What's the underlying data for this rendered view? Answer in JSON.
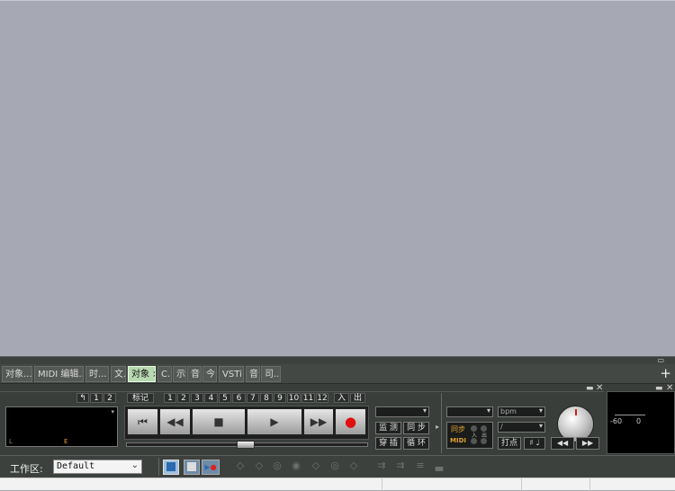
{
  "tabs": [
    {
      "label": "对象..."
    },
    {
      "label": "MIDI 编辑..."
    },
    {
      "label": "时..."
    },
    {
      "label": "文..."
    },
    {
      "label": "对象 ×"
    },
    {
      "label": "C..."
    },
    {
      "label": "示..."
    },
    {
      "label": "音..."
    },
    {
      "label": "今..."
    },
    {
      "label": "VSTi"
    },
    {
      "label": "音..."
    },
    {
      "label": "司..."
    }
  ],
  "add_tab_label": "+",
  "transport": {
    "back_label": "↰",
    "page1": "1",
    "page2": "2",
    "marker_label": "标记",
    "markers": [
      "1",
      "2",
      "3",
      "4",
      "5",
      "6",
      "7",
      "8",
      "9",
      "10",
      "11",
      "12"
    ],
    "in_label": "入",
    "out_label": "出",
    "display_left": "L",
    "display_end": "E",
    "rewind_start": "⏮",
    "rewind": "◀◀",
    "stop": "■",
    "play": "▶",
    "forward": "▶▶",
    "record": "●"
  },
  "switches": {
    "monitor": "监 测",
    "sync": "同 步",
    "punch": "穿 插",
    "loop": "循 环"
  },
  "tempo": {
    "bpm_value": "bpm",
    "sig_value": "/",
    "sync_label": "同步",
    "midi_label": "MIDI",
    "in_label": "入",
    "out_label": "出",
    "tap_label": "打点"
  },
  "meter": {
    "left_value": "-60",
    "right_value": "0"
  },
  "workspace": {
    "label": "工作区:",
    "value": "Default"
  }
}
